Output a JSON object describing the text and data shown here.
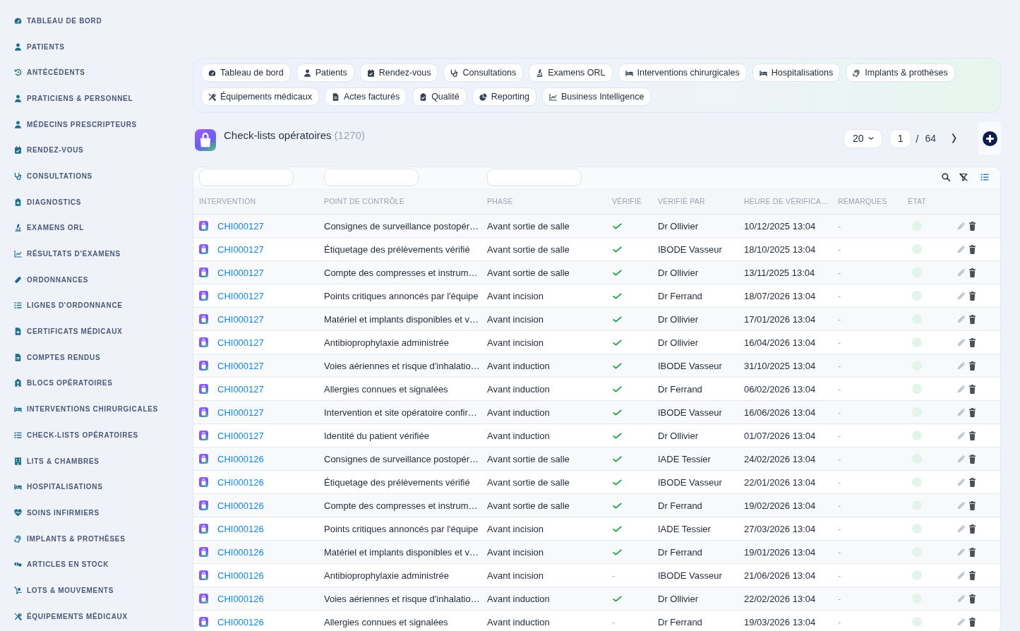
{
  "sidebar": {
    "items": [
      {
        "label": "TABLEAU DE BORD",
        "selected": false
      },
      {
        "label": "PATIENTS",
        "selected": false
      },
      {
        "label": "ANTÉCÉDENTS",
        "selected": false
      },
      {
        "label": "PRATICIENS & PERSONNEL",
        "selected": false
      },
      {
        "label": "MÉDECINS PRESCRIPTEURS",
        "selected": false
      },
      {
        "label": "RENDEZ-VOUS",
        "selected": false
      },
      {
        "label": "CONSULTATIONS",
        "selected": false
      },
      {
        "label": "DIAGNOSTICS",
        "selected": false
      },
      {
        "label": "EXAMENS ORL",
        "selected": false
      },
      {
        "label": "RÉSULTATS D'EXAMENS",
        "selected": false
      },
      {
        "label": "ORDONNANCES",
        "selected": false
      },
      {
        "label": "LIGNES D'ORDONNANCE",
        "selected": false
      },
      {
        "label": "CERTIFICATS MÉDICAUX",
        "selected": false
      },
      {
        "label": "COMPTES RENDUS",
        "selected": false
      },
      {
        "label": "BLOCS OPÉRATOIRES",
        "selected": false
      },
      {
        "label": "INTERVENTIONS CHIRURGICALES",
        "selected": false
      },
      {
        "label": "CHECK-LISTS OPÉRATOIRES",
        "selected": false
      },
      {
        "label": "LITS & CHAMBRES",
        "selected": false
      },
      {
        "label": "HOSPITALISATIONS",
        "selected": false
      },
      {
        "label": "SOINS INFIRMIERS",
        "selected": false
      },
      {
        "label": "IMPLANTS & PROTHÈSES",
        "selected": false
      },
      {
        "label": "ARTICLES EN STOCK",
        "selected": false
      },
      {
        "label": "LOTS & MOUVEMENTS",
        "selected": false
      },
      {
        "label": "ÉQUIPEMENTS MÉDICAUX",
        "selected": false
      }
    ]
  },
  "nav_tabs": [
    {
      "label": "Tableau de bord",
      "selected": false
    },
    {
      "label": "Patients",
      "selected": false
    },
    {
      "label": "Rendez-vous",
      "selected": false
    },
    {
      "label": "Consultations",
      "selected": false
    },
    {
      "label": "Examens ORL",
      "selected": false
    },
    {
      "label": "Interventions chirurgicales",
      "selected": false
    },
    {
      "label": "Hospitalisations",
      "selected": false
    },
    {
      "label": "Implants & prothèses",
      "selected": false
    },
    {
      "label": "Équipements médicaux",
      "selected": false
    },
    {
      "label": "Actes facturés",
      "selected": false
    },
    {
      "label": "Qualité",
      "selected": false
    },
    {
      "label": "Reporting",
      "selected": false
    },
    {
      "label": "Business Intelligence",
      "selected": false
    }
  ],
  "header": {
    "title": "Check-lists opératoires",
    "count": "(1270)",
    "page_size": "20",
    "page": "1",
    "page_separator": "/",
    "total_pages": "64"
  },
  "table": {
    "columns": [
      {
        "label": "INTERVENTION",
        "filterable": true
      },
      {
        "label": "POINT DE CONTRÔLE",
        "filterable": true
      },
      {
        "label": "PHASE",
        "filterable": true
      },
      {
        "label": "VÉRIFIÉ",
        "filterable": false
      },
      {
        "label": "VÉRIFIÉ PAR",
        "filterable": false
      },
      {
        "label": "HEURE DE VÉRIFICA…",
        "filterable": false
      },
      {
        "label": "REMARQUES",
        "filterable": false
      },
      {
        "label": "ÉTAT",
        "filterable": false
      }
    ],
    "rows": [
      {
        "intervention": "CHI000127",
        "control_point": "Consignes de surveillance postopér…",
        "phase": "Avant sortie de salle",
        "verified": true,
        "verified_by": "Dr Ollivier",
        "verified_at": "10/12/2025 13:04",
        "remarks": "-",
        "color": "#e3f5eb"
      },
      {
        "intervention": "CHI000127",
        "control_point": "Étiquetage des prélèvements vérifié",
        "phase": "Avant sortie de salle",
        "verified": true,
        "verified_by": "IBODE Vasseur",
        "verified_at": "18/10/2025 13:04",
        "remarks": "-",
        "color": "#e3f5eb"
      },
      {
        "intervention": "CHI000127",
        "control_point": "Compte des compresses et instrum…",
        "phase": "Avant sortie de salle",
        "verified": true,
        "verified_by": "Dr Ollivier",
        "verified_at": "13/11/2025 13:04",
        "remarks": "-",
        "color": "#e3f5eb"
      },
      {
        "intervention": "CHI000127",
        "control_point": "Points critiques annoncés par l'équipe",
        "phase": "Avant incision",
        "verified": true,
        "verified_by": "Dr Ferrand",
        "verified_at": "18/07/2026 13:04",
        "remarks": "-",
        "color": "#e3f5eb"
      },
      {
        "intervention": "CHI000127",
        "control_point": "Matériel et implants disponibles et v…",
        "phase": "Avant incision",
        "verified": true,
        "verified_by": "Dr Ollivier",
        "verified_at": "17/01/2026 13:04",
        "remarks": "-",
        "color": "#e3f5eb"
      },
      {
        "intervention": "CHI000127",
        "control_point": "Antibioprophylaxie administrée",
        "phase": "Avant incision",
        "verified": true,
        "verified_by": "Dr Ollivier",
        "verified_at": "16/04/2026 13:04",
        "remarks": "-",
        "color": "#e3f5eb"
      },
      {
        "intervention": "CHI000127",
        "control_point": "Voies aériennes et risque d'inhalatio…",
        "phase": "Avant induction",
        "verified": true,
        "verified_by": "IBODE Vasseur",
        "verified_at": "31/10/2025 13:04",
        "remarks": "-",
        "color": "#e3f5eb"
      },
      {
        "intervention": "CHI000127",
        "control_point": "Allergies connues et signalées",
        "phase": "Avant induction",
        "verified": true,
        "verified_by": "Dr Ferrand",
        "verified_at": "06/02/2026 13:04",
        "remarks": "-",
        "color": "#e3f5eb"
      },
      {
        "intervention": "CHI000127",
        "control_point": "Intervention et site opératoire confir…",
        "phase": "Avant induction",
        "verified": true,
        "verified_by": "IBODE Vasseur",
        "verified_at": "16/06/2026 13:04",
        "remarks": "-",
        "color": "#e3f5eb"
      },
      {
        "intervention": "CHI000127",
        "control_point": "Identité du patient vérifiée",
        "phase": "Avant induction",
        "verified": true,
        "verified_by": "Dr Ollivier",
        "verified_at": "01/07/2026 13:04",
        "remarks": "-",
        "color": "#e3f5eb"
      },
      {
        "intervention": "CHI000126",
        "control_point": "Consignes de surveillance postopér…",
        "phase": "Avant sortie de salle",
        "verified": true,
        "verified_by": "IADE Tessier",
        "verified_at": "24/02/2026 13:04",
        "remarks": "-",
        "color": "#e3f5eb"
      },
      {
        "intervention": "CHI000126",
        "control_point": "Étiquetage des prélèvements vérifié",
        "phase": "Avant sortie de salle",
        "verified": true,
        "verified_by": "IBODE Vasseur",
        "verified_at": "22/01/2026 13:04",
        "remarks": "-",
        "color": "#e3f5eb"
      },
      {
        "intervention": "CHI000126",
        "control_point": "Compte des compresses et instrum…",
        "phase": "Avant sortie de salle",
        "verified": true,
        "verified_by": "Dr Ferrand",
        "verified_at": "19/02/2026 13:04",
        "remarks": "-",
        "color": "#e3f5eb"
      },
      {
        "intervention": "CHI000126",
        "control_point": "Points critiques annoncés par l'équipe",
        "phase": "Avant incision",
        "verified": true,
        "verified_by": "IADE Tessier",
        "verified_at": "27/03/2026 13:04",
        "remarks": "-",
        "color": "#e3f5eb"
      },
      {
        "intervention": "CHI000126",
        "control_point": "Matériel et implants disponibles et v…",
        "phase": "Avant incision",
        "verified": true,
        "verified_by": "Dr Ferrand",
        "verified_at": "19/01/2026 13:04",
        "remarks": "-",
        "color": "#e3f5eb"
      },
      {
        "intervention": "CHI000126",
        "control_point": "Antibioprophylaxie administrée",
        "phase": "Avant incision",
        "verified": false,
        "verified_label": "-",
        "verified_by": "IBODE Vasseur",
        "verified_at": "21/06/2026 13:04",
        "remarks": "-",
        "color": "#e3f5eb"
      },
      {
        "intervention": "CHI000126",
        "control_point": "Voies aériennes et risque d'inhalatio…",
        "phase": "Avant induction",
        "verified": true,
        "verified_by": "Dr Ollivier",
        "verified_at": "22/02/2026 13:04",
        "remarks": "-",
        "color": "#e3f5eb"
      },
      {
        "intervention": "CHI000126",
        "control_point": "Allergies connues et signalées",
        "phase": "Avant induction",
        "verified": false,
        "verified_label": "-",
        "verified_by": "Dr Ferrand",
        "verified_at": "19/03/2026 13:04",
        "remarks": "-",
        "color": "#e3f5eb"
      }
    ]
  }
}
